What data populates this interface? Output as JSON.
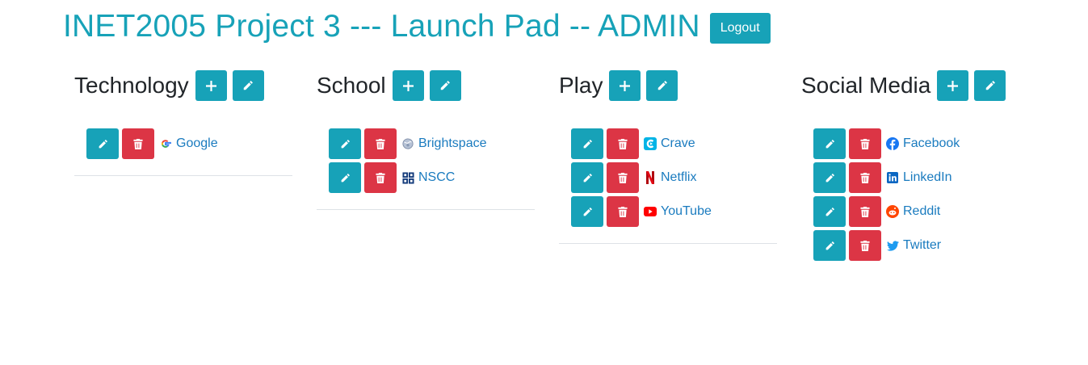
{
  "header": {
    "title": "INET2005 Project 3 --- Launch Pad -- ADMIN",
    "logout_label": "Logout"
  },
  "colors": {
    "accent": "#17a2b8",
    "danger": "#dc3545",
    "link": "#1a7bbf"
  },
  "categories": [
    {
      "title": "Technology",
      "links": [
        {
          "label": "Google",
          "icon": "google-icon"
        }
      ]
    },
    {
      "title": "School",
      "links": [
        {
          "label": "Brightspace",
          "icon": "brightspace-icon"
        },
        {
          "label": "NSCC",
          "icon": "nscc-icon"
        }
      ]
    },
    {
      "title": "Play",
      "links": [
        {
          "label": "Crave",
          "icon": "crave-icon"
        },
        {
          "label": "Netflix",
          "icon": "netflix-icon"
        },
        {
          "label": "YouTube",
          "icon": "youtube-icon"
        }
      ]
    },
    {
      "title": "Social Media",
      "links": [
        {
          "label": "Facebook",
          "icon": "facebook-icon"
        },
        {
          "label": "LinkedIn",
          "icon": "linkedin-icon"
        },
        {
          "label": "Reddit",
          "icon": "reddit-icon"
        },
        {
          "label": "Twitter",
          "icon": "twitter-icon"
        }
      ]
    }
  ]
}
